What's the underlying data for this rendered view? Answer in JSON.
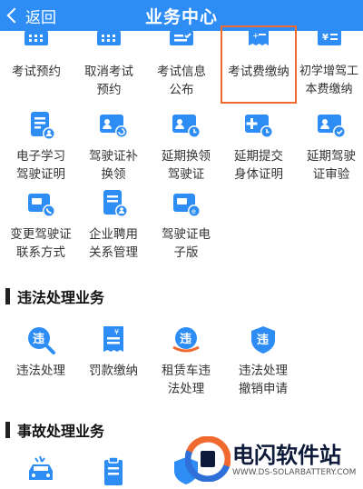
{
  "header": {
    "back_label": "返回",
    "title": "业务中心"
  },
  "colors": {
    "header": "#2e8df5",
    "icon_blue": "#2e8df5",
    "highlight": "#f06a2f",
    "text": "#333333"
  },
  "top_grid": [
    {
      "icon": "calendar-icon",
      "lines": [
        "考试预约"
      ]
    },
    {
      "icon": "calendar-cancel-icon",
      "lines": [
        "取消考试",
        "预约"
      ]
    },
    {
      "icon": "info-card-icon",
      "lines": [
        "考试信息",
        "公布"
      ]
    },
    {
      "icon": "fee-receipt-icon",
      "lines": [
        "考试费缴纳"
      ]
    },
    {
      "icon": "yuan-receipt-icon",
      "lines": [
        "初学增驾工",
        "本费缴纳"
      ]
    }
  ],
  "grid2": [
    {
      "icon": "document-user-icon",
      "lines": [
        "电子学习",
        "驾驶证明"
      ]
    },
    {
      "icon": "license-refresh-icon",
      "lines": [
        "驾驶证补",
        "换领"
      ]
    },
    {
      "icon": "license-clock-icon",
      "lines": [
        "延期换领",
        "驾驶证"
      ]
    },
    {
      "icon": "add-clock-icon",
      "lines": [
        "延期提交",
        "身体证明"
      ]
    },
    {
      "icon": "license-check-icon",
      "lines": [
        "延期驾驶",
        "证审验"
      ]
    }
  ],
  "grid3": [
    {
      "icon": "card-phone-icon",
      "lines": [
        "变更驾驶证",
        "联系方式"
      ]
    },
    {
      "icon": "hire-document-icon",
      "lines": [
        "企业聘用",
        "关系管理"
      ]
    },
    {
      "icon": "e-license-icon",
      "lines": [
        "驾驶证电",
        "子版"
      ]
    }
  ],
  "section_violation": "违法处理业务",
  "violation_grid": [
    {
      "icon": "violation-search-icon",
      "lines": [
        "违法处理"
      ]
    },
    {
      "icon": "fine-receipt-icon",
      "lines": [
        "罚款缴纳"
      ]
    },
    {
      "icon": "rental-violation-icon",
      "lines": [
        "租赁车违",
        "法处理"
      ]
    },
    {
      "icon": "violation-cancel-icon",
      "lines": [
        "违法处理",
        "撤销申请"
      ]
    }
  ],
  "section_accident": "事故处理业务",
  "accident_grid": [
    {
      "icon": "car-accident-icon",
      "lines": []
    },
    {
      "icon": "form-icon",
      "lines": []
    },
    {
      "icon": "shield-icon",
      "lines": []
    }
  ],
  "watermark": {
    "name": "电闪软件站",
    "url": "WWW.DS-SOLARBATTERY.COM"
  }
}
